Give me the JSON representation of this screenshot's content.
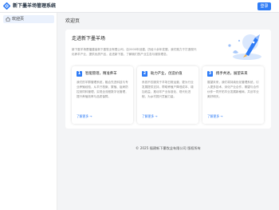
{
  "header": {
    "app_title": "新下墨羊场管理系统",
    "login_label": "登录"
  },
  "sidebar": {
    "items": [
      {
        "label": "欢迎页",
        "icon": "home-icon",
        "active": true
      }
    ]
  },
  "page": {
    "title": "欢迎页"
  },
  "welcome": {
    "title": "走进新下墨羊场",
    "description": "新下墨羊场是福建省新下墨牧业有限公司，自2000年创建，历经十余年发展，我们致力于打造现代化养羊产业，提供优质产品，走进新下墨，了解我们的产业生态与服务理念。"
  },
  "cards": [
    {
      "number": "1",
      "title": "智能管理，精准养羊",
      "description": "我们的羊群管理系统，融合先进科技与专业养殖经验，从羊只档案、繁殖、疫病防控到饲料管理，实现全流程数字化管理，提升养殖效率与品质保障。",
      "link": "了解更多 →"
    },
    {
      "number": "2",
      "title": "助力产业，创造价值",
      "description": "系统不仅服务于羊场日常运营，更为行业发展提供支持，帮助养殖户降低成本、增加收益，推动羊产业标准化、现代化进程，为乡村振兴贡献力量。",
      "link": "了解更多 →"
    },
    {
      "number": "3",
      "title": "携手共进，展望未来",
      "description": "展望未来，我们将持续优化管理系统，引入更多技术，深化产业合作，期望与合作伙伴一同开拓羊业发展新格局，共创羊业美好明天。",
      "link": "了解更多 →"
    }
  ],
  "footer": {
    "text": "© 2025 福建新下墨牧业有限公司 版权所有"
  },
  "colors": {
    "accent": "#2f7cf6",
    "background": "#f3f4f6",
    "sidebar_active": "#eaf1fd"
  }
}
